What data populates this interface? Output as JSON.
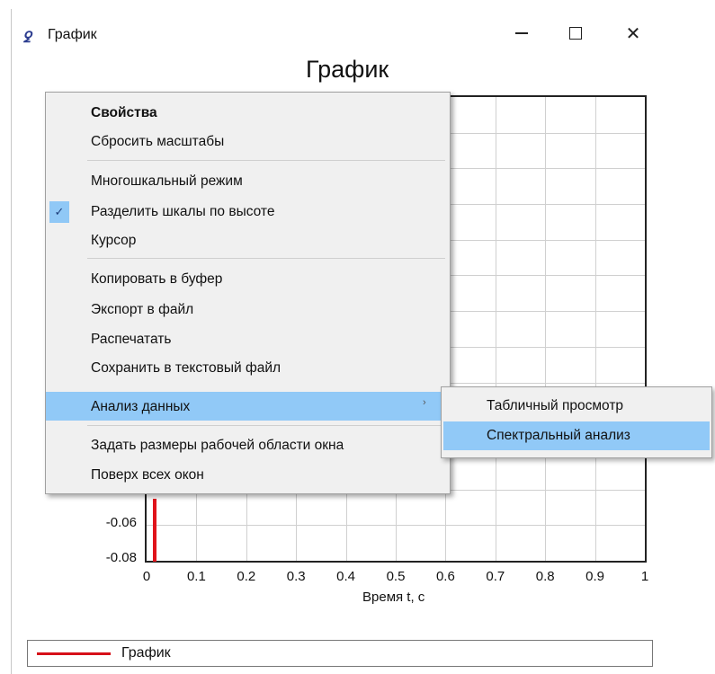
{
  "window": {
    "title": "График",
    "app_icon_glyph": "ꝿ",
    "minimize_label": "",
    "close_glyph": "✕"
  },
  "plot": {
    "title": "График",
    "x_label": "Время t, с",
    "x_ticks": [
      "0",
      "0.1",
      "0.2",
      "0.3",
      "0.4",
      "0.5",
      "0.6",
      "0.7",
      "0.8",
      "0.9",
      "1"
    ],
    "y_ticks_visible": [
      "-0.06",
      "-0.08"
    ],
    "series_color": "#e0131b"
  },
  "chart_data": {
    "type": "line",
    "title": "График",
    "xlabel": "Время t, с",
    "ylabel": "",
    "xlim": [
      0,
      1
    ],
    "x_ticks": [
      0,
      0.1,
      0.2,
      0.3,
      0.4,
      0.5,
      0.6,
      0.7,
      0.8,
      0.9,
      1
    ],
    "y_ticks_visible": [
      -0.06,
      -0.08
    ],
    "grid": true,
    "legend_placement": "bottom",
    "series": [
      {
        "name": "График",
        "color": "#e0131b"
      }
    ]
  },
  "legend": {
    "items": [
      {
        "label": "График",
        "color": "#d61019"
      }
    ]
  },
  "context_menu": {
    "items": [
      {
        "label": "Свойства",
        "bold": true
      },
      {
        "label": "Сбросить масштабы"
      },
      {
        "label": "Многошкальный режим"
      },
      {
        "label": "Разделить шкалы по высоте",
        "checked": true
      },
      {
        "label": "Курсор"
      },
      {
        "label": "Копировать в буфер"
      },
      {
        "label": "Экспорт в файл"
      },
      {
        "label": "Распечатать"
      },
      {
        "label": "Сохранить в текстовый файл"
      },
      {
        "label": "Анализ данных",
        "highlighted": true,
        "has_submenu": true
      },
      {
        "label": "Задать размеры рабочей области окна"
      },
      {
        "label": "Поверх всех окон"
      }
    ],
    "check_glyph": "✓",
    "submenu_arrow": "›"
  },
  "submenu": {
    "items": [
      {
        "label": "Табличный просмотр"
      },
      {
        "label": "Спектральный анализ",
        "highlighted": true
      }
    ]
  },
  "colors": {
    "menu_bg": "#f0f0f0",
    "highlight": "#91c9f7"
  }
}
